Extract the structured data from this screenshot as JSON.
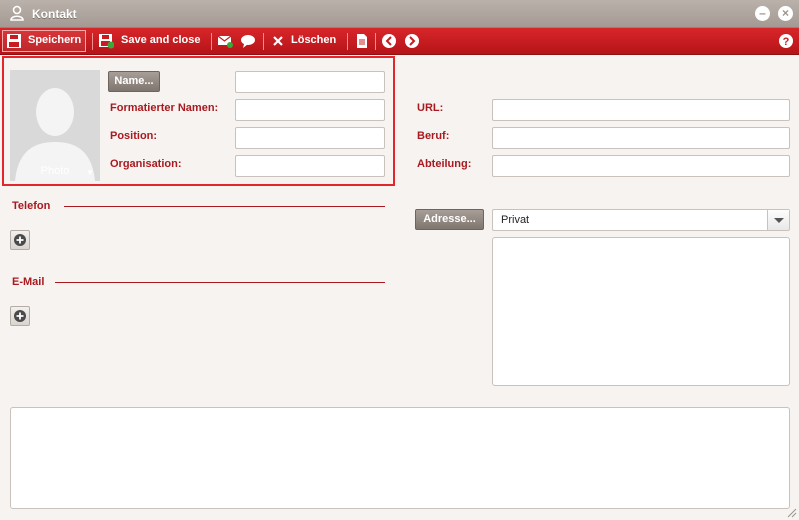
{
  "window": {
    "title": "Kontakt",
    "minimize_icon": "minus-icon",
    "close_icon": "close-icon"
  },
  "toolbar": {
    "save_label": "Speichern",
    "save_close_label": "Save and close",
    "delete_label": "Löschen"
  },
  "photo": {
    "caption": "Photo"
  },
  "form": {
    "name_button": "Name...",
    "formatted_name_label": "Formatierter Namen:",
    "position_label": "Position:",
    "organisation_label": "Organisation:",
    "url_label": "URL:",
    "beruf_label": "Beruf:",
    "abteilung_label": "Abteilung:"
  },
  "sections": {
    "telefon": "Telefon",
    "email": "E-Mail"
  },
  "address": {
    "button": "Adresse...",
    "selected": "Privat"
  },
  "colors": {
    "toolbar_red": "#c81c20",
    "label_red": "#a81a1f",
    "titlebar_grey": "#aea49d"
  }
}
